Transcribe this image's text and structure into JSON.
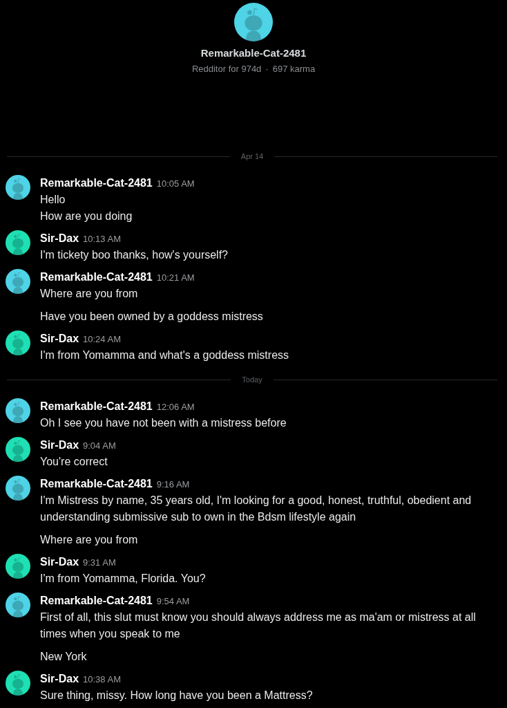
{
  "profile": {
    "username": "Remarkable-Cat-2481",
    "age": "Redditor for 974d",
    "separator": "·",
    "karma": "697 karma",
    "color": "#4fd3e6"
  },
  "sections": [
    {
      "date": "Apr 14",
      "groups": [
        {
          "author": "Remarkable-Cat-2481",
          "time": "10:05 AM",
          "color": "#4fd3e6",
          "messages": [
            [
              "Hello",
              "How are you doing"
            ]
          ]
        },
        {
          "author": "Sir-Dax",
          "time": "10:13 AM",
          "color": "#1ee0b4",
          "messages": [
            [
              "I'm tickety boo thanks, how's yourself?"
            ]
          ]
        },
        {
          "author": "Remarkable-Cat-2481",
          "time": "10:21 AM",
          "color": "#4fd3e6",
          "messages": [
            [
              "Where are you from"
            ],
            [
              "Have you been owned by a goddess mistress"
            ]
          ]
        },
        {
          "author": "Sir-Dax",
          "time": "10:24 AM",
          "color": "#1ee0b4",
          "messages": [
            [
              "I'm from Yomamma and what's a goddess mistress"
            ]
          ]
        }
      ]
    },
    {
      "date": "Today",
      "groups": [
        {
          "author": "Remarkable-Cat-2481",
          "time": "12:06 AM",
          "color": "#4fd3e6",
          "messages": [
            [
              "Oh I see you have not been with a mistress before"
            ]
          ]
        },
        {
          "author": "Sir-Dax",
          "time": "9:04 AM",
          "color": "#1ee0b4",
          "messages": [
            [
              "You're correct"
            ]
          ]
        },
        {
          "author": "Remarkable-Cat-2481",
          "time": "9:16 AM",
          "color": "#4fd3e6",
          "messages": [
            [
              "I'm Mistress by name, 35 years old, I'm looking for a good, honest, truthful, obedient and understanding submissive sub to own in the Bdsm lifestyle again"
            ],
            [
              "Where are you from"
            ]
          ]
        },
        {
          "author": "Sir-Dax",
          "time": "9:31 AM",
          "color": "#1ee0b4",
          "messages": [
            [
              "I'm from Yomamma, Florida. You?"
            ]
          ]
        },
        {
          "author": "Remarkable-Cat-2481",
          "time": "9:54 AM",
          "color": "#4fd3e6",
          "messages": [
            [
              "First of all, this slut must know you should always address me as ma'am or mistress at all times when you speak to me"
            ],
            [
              "New York"
            ]
          ]
        },
        {
          "author": "Sir-Dax",
          "time": "10:38 AM",
          "color": "#1ee0b4",
          "messages": [
            [
              "Sure thing, missy. How long have you been a Mattress?"
            ]
          ]
        }
      ]
    }
  ]
}
